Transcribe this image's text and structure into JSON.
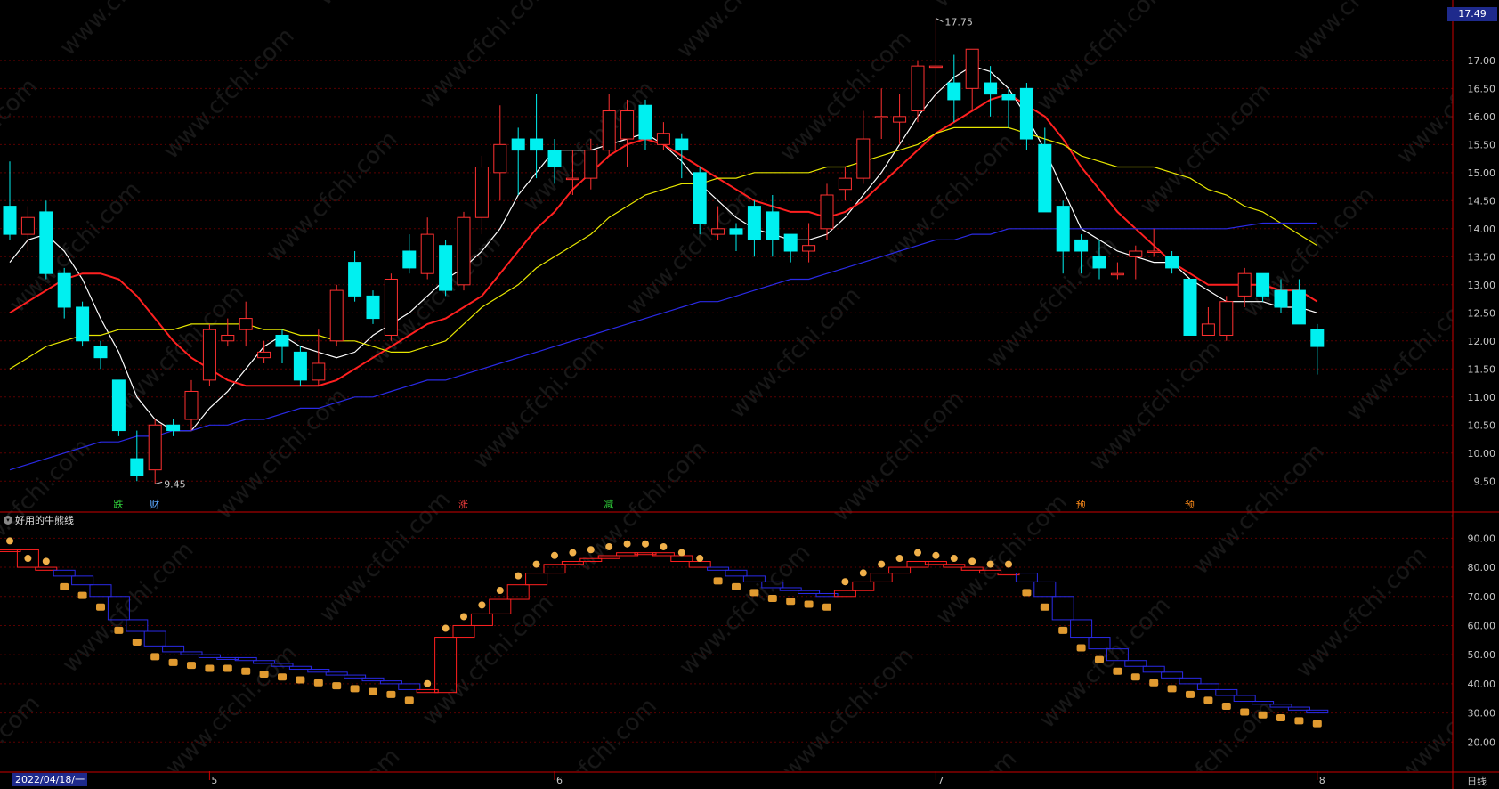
{
  "indicator_name": "好用的牛熊线",
  "last_price": "17.49",
  "date_label": "2022/04/18/一",
  "period_label": "日线",
  "month_labels": [
    "5",
    "6",
    "7",
    "8"
  ],
  "high_label": "17.75",
  "low_label": "9.45",
  "event_badges": [
    {
      "text": "跌",
      "color": "#2fd23a",
      "index": 6
    },
    {
      "text": "财",
      "color": "#5aa8ff",
      "index": 8
    },
    {
      "text": "涨",
      "color": "#ff4040",
      "index": 25
    },
    {
      "text": "减",
      "color": "#2fd23a",
      "index": 33
    },
    {
      "text": "预",
      "color": "#ff8c1a",
      "index": 59
    },
    {
      "text": "预",
      "color": "#ff8c1a",
      "index": 65
    }
  ],
  "colors": {
    "up": "#ff3030",
    "down": "#00f0f0",
    "ma5": "#ffffff",
    "ma10": "#ff2020",
    "ma20": "#e6e600",
    "ma60": "#2a2ae6",
    "grid": "#5a0000",
    "bull": "#ff2020",
    "bear": "#2a2ae6"
  },
  "chart_data": [
    {
      "type": "candlestick",
      "title": "",
      "ylim": [
        9.25,
        17.95
      ],
      "yticks": [
        9.5,
        10.0,
        10.5,
        11.0,
        11.5,
        12.0,
        12.5,
        13.0,
        13.5,
        14.0,
        14.5,
        15.0,
        15.5,
        16.0,
        16.5,
        17.0
      ],
      "candles": [
        [
          14.4,
          13.9,
          15.2,
          13.8
        ],
        [
          13.9,
          14.2,
          14.4,
          13.6
        ],
        [
          14.3,
          13.2,
          14.5,
          13.1
        ],
        [
          13.2,
          12.6,
          13.3,
          12.4
        ],
        [
          12.6,
          12.0,
          12.7,
          11.9
        ],
        [
          11.9,
          11.7,
          12.0,
          11.5
        ],
        [
          11.3,
          10.4,
          11.3,
          10.3
        ],
        [
          9.9,
          9.6,
          10.4,
          9.5
        ],
        [
          9.7,
          10.5,
          10.6,
          9.45
        ],
        [
          10.5,
          10.4,
          10.6,
          10.3
        ],
        [
          10.6,
          11.1,
          11.3,
          10.4
        ],
        [
          11.3,
          12.2,
          12.3,
          11.2
        ],
        [
          12.0,
          12.1,
          12.4,
          11.9
        ],
        [
          12.2,
          12.4,
          12.7,
          11.9
        ],
        [
          11.7,
          11.8,
          12.0,
          11.6
        ],
        [
          12.1,
          11.9,
          12.2,
          11.6
        ],
        [
          11.8,
          11.3,
          11.9,
          11.2
        ],
        [
          11.3,
          11.6,
          12.2,
          11.2
        ],
        [
          12.0,
          12.9,
          13.0,
          11.9
        ],
        [
          13.4,
          12.8,
          13.6,
          12.7
        ],
        [
          12.8,
          12.4,
          12.9,
          12.3
        ],
        [
          12.1,
          13.1,
          13.2,
          12.0
        ],
        [
          13.6,
          13.3,
          13.9,
          13.2
        ],
        [
          13.2,
          13.9,
          14.2,
          13.1
        ],
        [
          13.7,
          12.9,
          13.8,
          12.8
        ],
        [
          13.0,
          14.2,
          14.3,
          12.9
        ],
        [
          14.2,
          15.1,
          15.3,
          13.9
        ],
        [
          15.0,
          15.5,
          16.2,
          14.5
        ],
        [
          15.6,
          15.4,
          15.8,
          14.6
        ],
        [
          15.6,
          15.4,
          16.4,
          14.9
        ],
        [
          15.4,
          15.1,
          15.6,
          14.8
        ],
        [
          14.9,
          14.9,
          15.4,
          14.6
        ],
        [
          14.9,
          15.4,
          15.6,
          14.7
        ],
        [
          15.4,
          16.1,
          16.4,
          15.3
        ],
        [
          15.6,
          16.1,
          16.3,
          15.1
        ],
        [
          16.2,
          15.6,
          16.3,
          15.4
        ],
        [
          15.5,
          15.7,
          15.9,
          15.4
        ],
        [
          15.6,
          15.4,
          15.7,
          14.9
        ],
        [
          15.0,
          14.1,
          15.1,
          13.9
        ],
        [
          13.9,
          14.0,
          14.4,
          13.8
        ],
        [
          14.0,
          13.9,
          14.1,
          13.6
        ],
        [
          14.4,
          13.8,
          14.5,
          13.5
        ],
        [
          14.3,
          13.8,
          14.6,
          13.5
        ],
        [
          13.9,
          13.6,
          13.9,
          13.4
        ],
        [
          13.6,
          13.7,
          14.1,
          13.4
        ],
        [
          14.0,
          14.6,
          14.8,
          13.8
        ],
        [
          14.7,
          14.9,
          15.1,
          14.5
        ],
        [
          14.9,
          15.6,
          16.1,
          14.8
        ],
        [
          16.0,
          16.0,
          16.5,
          15.6
        ],
        [
          15.9,
          16.0,
          16.4,
          15.5
        ],
        [
          16.1,
          16.9,
          17.0,
          15.9
        ],
        [
          16.9,
          16.9,
          17.75,
          16.0
        ],
        [
          16.6,
          16.3,
          17.1,
          15.9
        ],
        [
          16.5,
          17.2,
          17.2,
          16.1
        ],
        [
          16.6,
          16.4,
          16.9,
          16.0
        ],
        [
          16.4,
          16.3,
          16.5,
          15.8
        ],
        [
          16.5,
          15.6,
          16.6,
          15.4
        ],
        [
          15.5,
          14.3,
          15.8,
          14.3
        ],
        [
          14.4,
          13.6,
          14.5,
          13.2
        ],
        [
          13.8,
          13.6,
          13.9,
          13.2
        ],
        [
          13.5,
          13.3,
          13.8,
          13.1
        ],
        [
          13.2,
          13.2,
          13.4,
          13.1
        ],
        [
          13.5,
          13.6,
          13.7,
          13.1
        ],
        [
          13.6,
          13.6,
          14.0,
          13.5
        ],
        [
          13.5,
          13.3,
          13.6,
          13.2
        ],
        [
          13.1,
          12.1,
          13.1,
          12.1
        ],
        [
          12.1,
          12.3,
          12.6,
          12.1
        ],
        [
          12.1,
          12.7,
          12.8,
          12.0
        ],
        [
          12.8,
          13.2,
          13.3,
          12.6
        ],
        [
          13.2,
          12.8,
          13.2,
          12.7
        ],
        [
          12.9,
          12.6,
          13.1,
          12.5
        ],
        [
          12.9,
          12.3,
          13.1,
          12.3
        ],
        [
          12.2,
          11.9,
          12.3,
          11.4
        ]
      ],
      "series": [
        {
          "kind": "ma",
          "color": "ma5",
          "values": [
            13.4,
            13.8,
            13.9,
            13.6,
            13.1,
            12.4,
            11.8,
            11.0,
            10.6,
            10.4,
            10.4,
            10.8,
            11.1,
            11.5,
            11.9,
            12.1,
            11.9,
            11.8,
            11.7,
            11.8,
            12.1,
            12.3,
            12.5,
            12.8,
            13.1,
            13.3,
            13.6,
            14.0,
            14.6,
            15.0,
            15.4,
            15.4,
            15.4,
            15.5,
            15.6,
            15.7,
            15.5,
            15.2,
            14.8,
            14.5,
            14.2,
            14.0,
            13.9,
            13.8,
            13.8,
            13.9,
            14.2,
            14.6,
            15.0,
            15.5,
            16.0,
            16.4,
            16.7,
            16.9,
            16.8,
            16.5,
            16.0,
            15.4,
            14.7,
            14.0,
            13.8,
            13.6,
            13.5,
            13.4,
            13.4,
            13.1,
            12.9,
            12.7,
            12.7,
            12.7,
            12.6,
            12.6,
            12.5
          ]
        },
        {
          "kind": "ma",
          "color": "ma10",
          "values": [
            12.5,
            12.7,
            12.9,
            13.1,
            13.2,
            13.2,
            13.1,
            12.8,
            12.4,
            12.0,
            11.7,
            11.5,
            11.3,
            11.2,
            11.2,
            11.2,
            11.2,
            11.2,
            11.3,
            11.5,
            11.7,
            11.9,
            12.1,
            12.3,
            12.4,
            12.6,
            12.8,
            13.2,
            13.6,
            14.0,
            14.3,
            14.7,
            15.0,
            15.3,
            15.5,
            15.6,
            15.5,
            15.3,
            15.1,
            14.9,
            14.7,
            14.5,
            14.4,
            14.3,
            14.3,
            14.2,
            14.3,
            14.5,
            14.8,
            15.1,
            15.4,
            15.7,
            15.9,
            16.1,
            16.3,
            16.4,
            16.2,
            16.0,
            15.6,
            15.1,
            14.7,
            14.3,
            14.0,
            13.7,
            13.4,
            13.2,
            13.0,
            13.0,
            13.0,
            13.0,
            12.9,
            12.9,
            12.7
          ]
        },
        {
          "kind": "ma",
          "color": "ma20",
          "values": [
            11.5,
            11.7,
            11.9,
            12.0,
            12.1,
            12.1,
            12.2,
            12.2,
            12.2,
            12.2,
            12.3,
            12.3,
            12.3,
            12.3,
            12.2,
            12.2,
            12.1,
            12.1,
            12.0,
            12.0,
            11.9,
            11.8,
            11.8,
            11.9,
            12.0,
            12.3,
            12.6,
            12.8,
            13.0,
            13.3,
            13.5,
            13.7,
            13.9,
            14.2,
            14.4,
            14.6,
            14.7,
            14.8,
            14.8,
            14.9,
            14.9,
            15.0,
            15.0,
            15.0,
            15.0,
            15.1,
            15.1,
            15.2,
            15.3,
            15.4,
            15.5,
            15.7,
            15.8,
            15.8,
            15.8,
            15.8,
            15.7,
            15.6,
            15.5,
            15.3,
            15.2,
            15.1,
            15.1,
            15.1,
            15.0,
            14.9,
            14.7,
            14.6,
            14.4,
            14.3,
            14.1,
            13.9,
            13.7
          ]
        },
        {
          "kind": "ma",
          "color": "ma60",
          "values": [
            9.7,
            9.8,
            9.9,
            10.0,
            10.1,
            10.2,
            10.2,
            10.3,
            10.3,
            10.4,
            10.4,
            10.5,
            10.5,
            10.6,
            10.6,
            10.7,
            10.8,
            10.8,
            10.9,
            11.0,
            11.0,
            11.1,
            11.2,
            11.3,
            11.3,
            11.4,
            11.5,
            11.6,
            11.7,
            11.8,
            11.9,
            12.0,
            12.1,
            12.2,
            12.3,
            12.4,
            12.5,
            12.6,
            12.7,
            12.7,
            12.8,
            12.9,
            13.0,
            13.1,
            13.1,
            13.2,
            13.3,
            13.4,
            13.5,
            13.6,
            13.7,
            13.8,
            13.8,
            13.9,
            13.9,
            14.0,
            14.0,
            14.0,
            14.0,
            14.0,
            14.0,
            14.0,
            14.0,
            14.0,
            14.0,
            14.0,
            14.0,
            14.0,
            14.05,
            14.1,
            14.1,
            14.1,
            14.1
          ]
        }
      ]
    },
    {
      "type": "indicator",
      "title": "好用的牛熊线",
      "ylim": [
        10,
        95
      ],
      "yticks": [
        20.0,
        30.0,
        40.0,
        50.0,
        60.0,
        70.0,
        80.0,
        90.0
      ],
      "line": [
        86,
        80,
        79,
        77,
        74,
        70,
        62,
        58,
        53,
        51,
        50,
        49,
        49,
        48,
        47,
        46,
        45,
        44,
        43,
        42,
        41,
        40,
        38,
        37,
        56,
        60,
        64,
        69,
        74,
        78,
        81,
        82,
        83,
        84,
        85,
        85,
        84,
        82,
        80,
        79,
        77,
        75,
        73,
        72,
        71,
        70,
        72,
        75,
        78,
        80,
        82,
        81,
        80,
        79,
        78,
        78,
        75,
        70,
        62,
        56,
        52,
        48,
        46,
        44,
        42,
        40,
        38,
        36,
        34,
        33,
        32,
        31,
        30
      ],
      "zone": [
        "bull",
        "bull",
        "bull",
        "bear",
        "bear",
        "bear",
        "bear",
        "bear",
        "bear",
        "bear",
        "bear",
        "bear",
        "bear",
        "bear",
        "bear",
        "bear",
        "bear",
        "bear",
        "bear",
        "bear",
        "bear",
        "bear",
        "bear",
        "bull",
        "bull",
        "bull",
        "bull",
        "bull",
        "bull",
        "bull",
        "bull",
        "bull",
        "bull",
        "bull",
        "bull",
        "bull",
        "bull",
        "bull",
        "bull",
        "bear",
        "bear",
        "bear",
        "bear",
        "bear",
        "bear",
        "bear",
        "bull",
        "bull",
        "bull",
        "bull",
        "bull",
        "bull",
        "bull",
        "bull",
        "bull",
        "bull",
        "bear",
        "bear",
        "bear",
        "bear",
        "bear",
        "bear",
        "bear",
        "bear",
        "bear",
        "bear",
        "bear",
        "bear",
        "bear",
        "bear",
        "bear",
        "bear",
        "bear"
      ]
    }
  ]
}
